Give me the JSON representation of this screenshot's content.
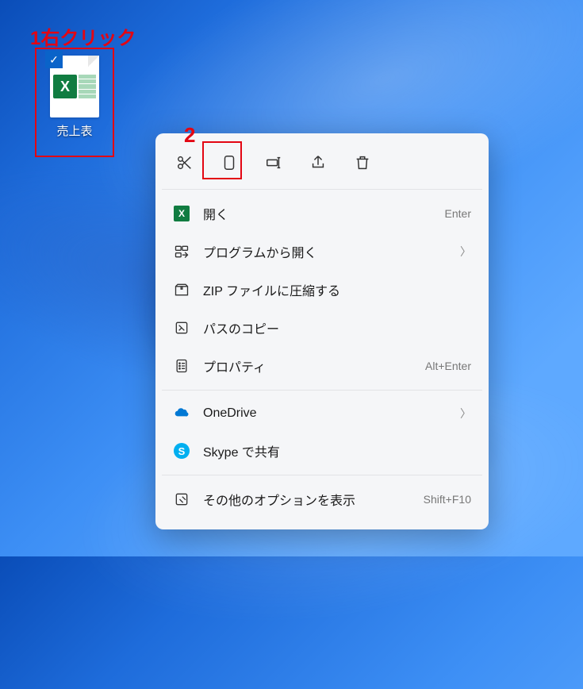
{
  "annotations": {
    "label1": "1右クリック",
    "label2": "2"
  },
  "desktop": {
    "file_name": "売上表",
    "file_type": "excel",
    "selected": true
  },
  "context_menu": {
    "actions": {
      "cut": "cut",
      "copy": "copy",
      "rename": "rename",
      "share": "share",
      "delete": "delete"
    },
    "items": [
      {
        "icon": "excel",
        "label": "開く",
        "shortcut": "Enter"
      },
      {
        "icon": "open-with",
        "label": "プログラムから開く",
        "submenu": true
      },
      {
        "icon": "zip",
        "label": "ZIP ファイルに圧縮する"
      },
      {
        "icon": "copy-path",
        "label": "パスのコピー"
      },
      {
        "icon": "properties",
        "label": "プロパティ",
        "shortcut": "Alt+Enter"
      }
    ],
    "cloud_items": [
      {
        "icon": "onedrive",
        "label": "OneDrive",
        "submenu": true
      },
      {
        "icon": "skype",
        "label": "Skype で共有"
      }
    ],
    "more": {
      "label": "その他のオプションを表示",
      "shortcut": "Shift+F10"
    }
  }
}
